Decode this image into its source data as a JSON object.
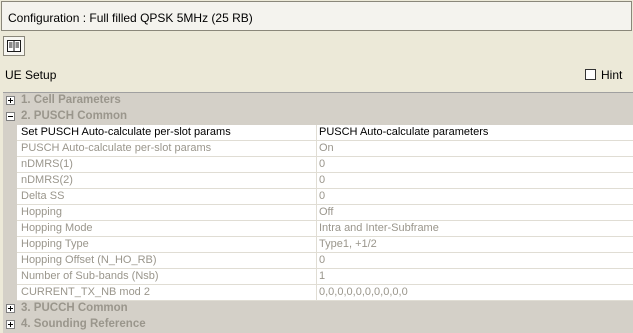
{
  "config": {
    "title": "Configuration : Full filled QPSK 5MHz (25 RB)"
  },
  "toolbar": {
    "icon": "book-icon"
  },
  "section": {
    "title": "UE Setup"
  },
  "hint": {
    "label": "Hint",
    "checked": false
  },
  "categories": {
    "cell": "1. Cell Parameters",
    "pusch": "2. PUSCH Common",
    "pucch": "3. PUCCH Common",
    "sounding": "4. Sounding Reference"
  },
  "props": [
    {
      "name": "Set PUSCH Auto-calculate per-slot params",
      "value": "PUSCH Auto-calculate parameters"
    },
    {
      "name": "PUSCH Auto-calculate per-slot params",
      "value": "On"
    },
    {
      "name": "nDMRS(1)",
      "value": "0"
    },
    {
      "name": "nDMRS(2)",
      "value": "0"
    },
    {
      "name": "Delta SS",
      "value": "0"
    },
    {
      "name": "Hopping",
      "value": "Off"
    },
    {
      "name": "Hopping Mode",
      "value": "Intra and Inter-Subframe"
    },
    {
      "name": "Hopping Type",
      "value": "Type1, +1/2"
    },
    {
      "name": "Hopping Offset (N_HO_RB)",
      "value": "0"
    },
    {
      "name": "Number of Sub-bands (Nsb)",
      "value": "1"
    },
    {
      "name": "CURRENT_TX_NB mod 2",
      "value": "0,0,0,0,0,0,0,0,0,0"
    }
  ]
}
